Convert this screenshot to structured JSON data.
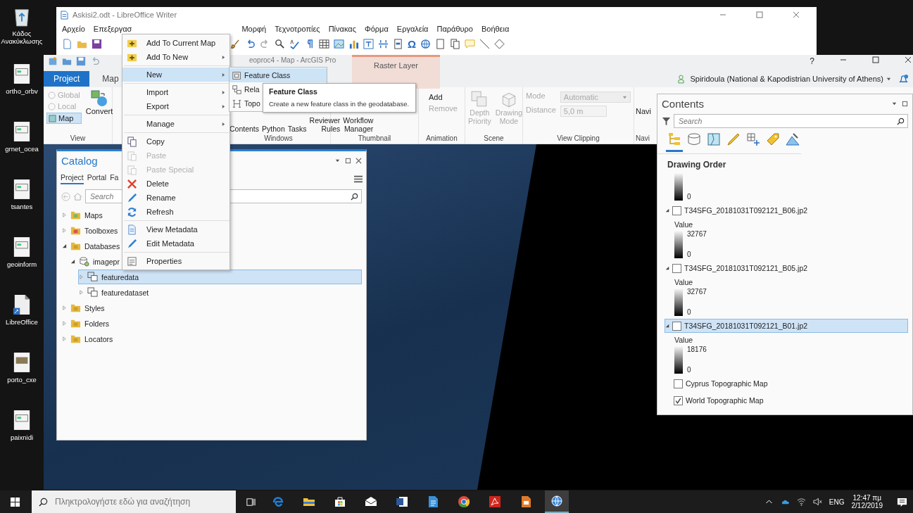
{
  "desktop_icons": [
    {
      "label": "Κάδος Ανακύκλωσης",
      "kind": "recycle"
    },
    {
      "label": "ortho_orbv",
      "kind": "document"
    },
    {
      "label": "grnet_ocea",
      "kind": "document"
    },
    {
      "label": "tsantes",
      "kind": "document"
    },
    {
      "label": "geoinform",
      "kind": "document"
    },
    {
      "label": "LibreOffice",
      "kind": "shortcut"
    },
    {
      "label": "porto_cxe",
      "kind": "photo"
    },
    {
      "label": "paixnidi",
      "kind": "document"
    }
  ],
  "writer_window": {
    "title": "Askisi2.odt - LibreOffice Writer",
    "menu_left": [
      "Αρχείο",
      "Επεξεργασ"
    ],
    "menu_right": [
      "Μορφή",
      "Τεχνοτροπίες",
      "Πίνακας",
      "Φόρμα",
      "Εργαλεία",
      "Παράθυρο",
      "Βοήθεια"
    ],
    "special_character": "Ω"
  },
  "arcgis_window": {
    "title": "eoproc4 - Map - ArcGIS Pro",
    "contextual_tab": "Raster Layer",
    "help": "?",
    "tabs": [
      {
        "label": "Project",
        "selected": true
      },
      {
        "label": "Map",
        "selected": false
      }
    ],
    "user": "Spiridoula (National & Kapodistrian University of Athens)"
  },
  "ribbon": {
    "view": {
      "label": "View",
      "buttons": [
        {
          "label": "Global",
          "disabled": true,
          "selected": false
        },
        {
          "label": "Local",
          "disabled": true,
          "selected": false
        },
        {
          "label": "Map",
          "disabled": false,
          "selected": true
        }
      ],
      "convert": "Convert"
    },
    "windows": {
      "label": "Windows",
      "buttons": [
        "Contents",
        "Python",
        "Tasks",
        "Reviewer Rules",
        "Workflow Manager"
      ]
    },
    "thumbnail": {
      "label": "Thumbnail"
    },
    "animation": {
      "label": "Animation",
      "buttons": [
        {
          "label": "Add",
          "disabled": false
        },
        {
          "label": "Remove",
          "disabled": true
        }
      ]
    },
    "scene": {
      "label": "Scene",
      "buttons": [
        {
          "label": "Depth Priority",
          "disabled": true
        },
        {
          "label": "Drawing Mode",
          "disabled": true
        }
      ]
    },
    "view_clipping": {
      "label": "View Clipping",
      "disabled": true,
      "mode_label": "Mode",
      "mode_value": "Automatic",
      "distance_label": "Distance",
      "distance_value": "5,0 m"
    },
    "navigation": {
      "button": "Navi",
      "label": "Navi"
    }
  },
  "catalog": {
    "title": "Catalog",
    "tabs": [
      {
        "label": "Project",
        "selected": true
      },
      {
        "label": "Portal",
        "selected": false
      },
      {
        "label": "Fa",
        "selected": false
      }
    ],
    "search": {
      "placeholder": "Search"
    },
    "tree": [
      {
        "label": "Maps",
        "kind": "maps",
        "expanded": false,
        "selected": false
      },
      {
        "label": "Toolboxes",
        "kind": "toolbox",
        "expanded": false,
        "selected": false
      },
      {
        "label": "Databases",
        "kind": "database",
        "expanded": true,
        "selected": false,
        "children": [
          {
            "label": "imagepr",
            "kind": "geodatabase",
            "expanded": true,
            "selected": false,
            "children": [
              {
                "label": "featuredata",
                "kind": "dataset",
                "expanded": false,
                "selected": true
              },
              {
                "label": "featuredataset",
                "kind": "dataset",
                "expanded": false,
                "selected": false
              }
            ]
          }
        ]
      },
      {
        "label": "Styles",
        "kind": "styles",
        "expanded": false,
        "selected": false
      },
      {
        "label": "Folders",
        "kind": "folder",
        "expanded": false,
        "selected": false
      },
      {
        "label": "Locators",
        "kind": "locator",
        "expanded": false,
        "selected": false
      }
    ]
  },
  "context_menu": {
    "groups": [
      [
        {
          "label": "Add To Current Map",
          "kind": "add",
          "submenu": false,
          "disabled": false,
          "selected": false
        },
        {
          "label": "Add To New",
          "kind": "add",
          "submenu": true,
          "disabled": false,
          "selected": false
        }
      ],
      [
        {
          "label": "New",
          "kind": "none",
          "submenu": true,
          "disabled": false,
          "selected": true
        }
      ],
      [
        {
          "label": "Import",
          "kind": "none",
          "submenu": true,
          "disabled": false,
          "selected": false
        },
        {
          "label": "Export",
          "kind": "none",
          "submenu": true,
          "disabled": false,
          "selected": false
        }
      ],
      [
        {
          "label": "Manage",
          "kind": "none",
          "submenu": true,
          "disabled": false,
          "selected": false
        }
      ],
      [
        {
          "label": "Copy",
          "kind": "copy",
          "submenu": false,
          "disabled": false,
          "selected": false
        },
        {
          "label": "Paste",
          "kind": "paste",
          "submenu": false,
          "disabled": true,
          "selected": false
        },
        {
          "label": "Paste Special",
          "kind": "paste",
          "submenu": false,
          "disabled": true,
          "selected": false
        },
        {
          "label": "Delete",
          "kind": "delete",
          "submenu": false,
          "disabled": false,
          "selected": false
        },
        {
          "label": "Rename",
          "kind": "pencil",
          "submenu": false,
          "disabled": false,
          "selected": false
        },
        {
          "label": "Refresh",
          "kind": "refresh",
          "submenu": false,
          "disabled": false,
          "selected": false
        }
      ],
      [
        {
          "label": "View Metadata",
          "kind": "metadata",
          "submenu": false,
          "disabled": false,
          "selected": false
        },
        {
          "label": "Edit Metadata",
          "kind": "pencil",
          "submenu": false,
          "disabled": false,
          "selected": false
        }
      ],
      [
        {
          "label": "Properties",
          "kind": "properties",
          "submenu": false,
          "disabled": false,
          "selected": false
        }
      ]
    ]
  },
  "submenu": {
    "items": [
      {
        "label": "Feature Class",
        "kind": "feature",
        "selected": true
      },
      {
        "label": "Rela",
        "kind": "relation",
        "selected": false
      },
      {
        "label": "Topo",
        "kind": "topology",
        "selected": false
      }
    ]
  },
  "tooltip": {
    "title": "Feature Class",
    "text": "Create a new feature class in the geodatabase."
  },
  "contents": {
    "title": "Contents",
    "search": {
      "placeholder": "Search"
    },
    "view_tabs": [
      {
        "kind": "order",
        "selected": true
      },
      {
        "kind": "source",
        "selected": false
      },
      {
        "kind": "selection",
        "selected": false
      },
      {
        "kind": "editing",
        "selected": false
      },
      {
        "kind": "snapping",
        "selected": false
      },
      {
        "kind": "labeling",
        "selected": false
      },
      {
        "kind": "perspective",
        "selected": false
      }
    ],
    "heading": "Drawing Order",
    "top_legend_min": "0",
    "layers": [
      {
        "kind": "raster",
        "name": "T34SFG_20181031T092121_B06.jp2",
        "checked": false,
        "expanded": true,
        "selected": false,
        "legend_label": "Value",
        "max": "32767",
        "min": "0"
      },
      {
        "kind": "raster",
        "name": "T34SFG_20181031T092121_B05.jp2",
        "checked": false,
        "expanded": true,
        "selected": false,
        "legend_label": "Value",
        "max": "32767",
        "min": "0"
      },
      {
        "kind": "raster",
        "name": "T34SFG_20181031T092121_B01.jp2",
        "checked": false,
        "expanded": true,
        "selected": true,
        "legend_label": "Value",
        "max": "18176",
        "min": "0"
      },
      {
        "kind": "basemap",
        "name": "Cyprus Topographic Map",
        "checked": false,
        "selected": false
      },
      {
        "kind": "basemap",
        "name": "World Topographic Map",
        "checked": true,
        "selected": false
      }
    ]
  },
  "taskbar": {
    "search_placeholder": "Πληκτρολογήστε εδώ για αναζήτηση",
    "apps": [
      {
        "kind": "browser",
        "selected": false
      },
      {
        "kind": "folder",
        "selected": false
      },
      {
        "kind": "store",
        "selected": false
      },
      {
        "kind": "mail",
        "selected": false
      },
      {
        "kind": "word",
        "selected": false
      },
      {
        "kind": "writer",
        "selected": false
      },
      {
        "kind": "chrome",
        "selected": false
      },
      {
        "kind": "pdf",
        "selected": false
      },
      {
        "kind": "impress",
        "selected": false
      },
      {
        "kind": "globe",
        "selected": true
      }
    ],
    "language": "ENG",
    "time": "12:47 πμ",
    "date": "2/12/2019"
  }
}
